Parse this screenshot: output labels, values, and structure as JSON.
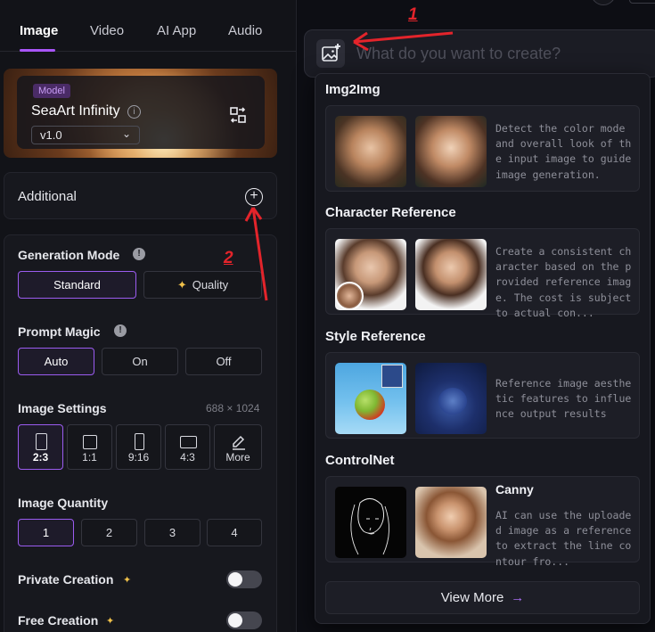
{
  "tabs": [
    {
      "label": "Image",
      "active": true
    },
    {
      "label": "Video",
      "active": false
    },
    {
      "label": "AI App",
      "active": false
    },
    {
      "label": "Audio",
      "active": false
    }
  ],
  "model": {
    "tag": "Model",
    "name": "SeaArt Infinity",
    "version": "v1.0"
  },
  "additional": {
    "label": "Additional"
  },
  "generation_mode": {
    "title": "Generation Mode",
    "options": [
      "Standard",
      "Quality"
    ],
    "selected": "Standard"
  },
  "prompt_magic": {
    "title": "Prompt Magic",
    "options": [
      "Auto",
      "On",
      "Off"
    ],
    "selected": "Auto"
  },
  "image_settings": {
    "title": "Image Settings",
    "dimensions": "688 × 1024",
    "ratios": [
      "2:3",
      "1:1",
      "9:16",
      "4:3"
    ],
    "more_label": "More",
    "selected": "2:3"
  },
  "image_quantity": {
    "title": "Image Quantity",
    "options": [
      "1",
      "2",
      "3",
      "4"
    ],
    "selected": "1"
  },
  "private_creation": {
    "label": "Private Creation",
    "enabled": false
  },
  "free_creation": {
    "label": "Free Creation",
    "enabled": false
  },
  "prompt": {
    "placeholder": "What do you want to create?"
  },
  "reference_menu": {
    "sections": [
      {
        "title": "Img2Img",
        "description": "Detect the color mode and overall look of the input image to guide image generation."
      },
      {
        "title": "Character Reference",
        "description": "Create a consistent character based on the provided reference image. The cost is subject to actual con..."
      },
      {
        "title": "Style Reference",
        "description": "Reference image aesthetic features to influence output results"
      },
      {
        "title": "ControlNet",
        "subtitle": "Canny",
        "description": "AI can use the uploaded image as a reference to extract the line contour fro..."
      }
    ],
    "view_more": "View More"
  },
  "annotations": {
    "one": "1",
    "two": "2",
    "color": "#e3242b"
  },
  "colors": {
    "accent": "#9b5cf0",
    "annotation": "#e3242b",
    "background": "#0c0d12"
  }
}
